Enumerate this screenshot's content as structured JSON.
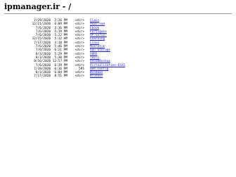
{
  "page": {
    "title": "ipmanager.ir - /"
  },
  "listing": {
    "entries": [
      {
        "date": "7/29/2020",
        "time": "2:26 PM",
        "type": "<dir>",
        "name": "Class"
      },
      {
        "date": "12/21/2020",
        "time": "6:09 PM",
        "type": "<dir>",
        "name": "download"
      },
      {
        "date": "7/6/2020",
        "time": "3:36 PM",
        "type": "<dir>",
        "name": "Ebook"
      },
      {
        "date": "7/6/2020",
        "time": "5:19 PM",
        "type": "<dir>",
        "name": "Fortigate"
      },
      {
        "date": "7/6/2020",
        "time": "5:22 PM",
        "type": "<dir>",
        "name": "HP-Server"
      },
      {
        "date": "12/15/2020",
        "time": "5:12 AM",
        "type": "<dir>",
        "name": "Learning"
      },
      {
        "date": "7/17/2020",
        "time": "3:18 PM",
        "type": "<dir>",
        "name": "Linux"
      },
      {
        "date": "7/6/2020",
        "time": "5:46 PM",
        "type": "<dir>",
        "name": "Mikrotik"
      },
      {
        "date": "7/6/2020",
        "time": "6:21 PM",
        "type": "<dir>",
        "name": "San-Storage"
      },
      {
        "date": "8/3/2020",
        "time": "5:29 PM",
        "type": "<dir>",
        "name": "SDRS"
      },
      {
        "date": "8/3/2020",
        "time": "5:30 PM",
        "type": "<dir>",
        "name": "Tools"
      },
      {
        "date": "8/16/2020",
        "time": "12:57 PM",
        "type": "<dir>",
        "name": "VeeamBackup"
      },
      {
        "date": "7/6/2020",
        "time": "6:39 PM",
        "type": "<dir>",
        "name": "Virtualization-ESXI"
      },
      {
        "date": "7/18/2020",
        "time": "6:16 PM",
        "type": "595",
        "name": "web.config"
      },
      {
        "date": "8/3/2020",
        "time": "6:04 PM",
        "type": "<dir>",
        "name": "Windows"
      },
      {
        "date": "7/17/2020",
        "time": "8:51 PM",
        "type": "<dir>",
        "name": "Windows"
      }
    ]
  }
}
